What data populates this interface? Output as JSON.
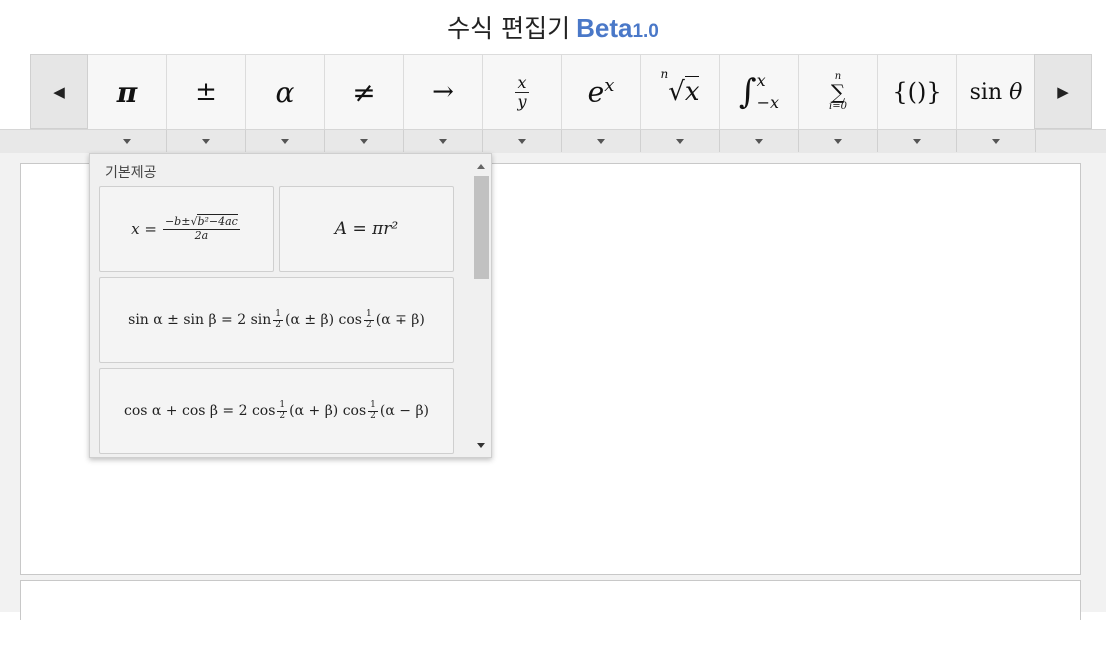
{
  "title": {
    "main": "수식 편집기",
    "beta": "Beta",
    "version": "1.0"
  },
  "toolbar": {
    "prev_icon": "triangle-left-icon",
    "next_icon": "triangle-right-icon",
    "symbols": [
      {
        "name": "pi",
        "label": "π"
      },
      {
        "name": "plus-minus",
        "label": "±"
      },
      {
        "name": "alpha",
        "label": "α"
      },
      {
        "name": "not-equal",
        "label": "≠"
      },
      {
        "name": "right-arrow",
        "label": "→"
      },
      {
        "name": "fraction",
        "num": "x",
        "den": "y"
      },
      {
        "name": "exponent",
        "base": "e",
        "exp": "x"
      },
      {
        "name": "nth-root",
        "index": "n",
        "radicand": "x"
      },
      {
        "name": "integral",
        "upper": "x",
        "lower": "−x"
      },
      {
        "name": "summation",
        "upper": "n",
        "lower": "i=0"
      },
      {
        "name": "brackets",
        "label": "{()}"
      },
      {
        "name": "sine",
        "label": "sin",
        "var": "θ"
      }
    ]
  },
  "dropdown": {
    "header": "기본제공",
    "formulas": {
      "quadratic": {
        "lhs": "x =",
        "num_pre": "−b±",
        "num_rad": "b²−4ac",
        "den": "2a"
      },
      "circle_area": {
        "text": "A = πr²"
      },
      "sum_to_product_sin": {
        "text_a": "sin α ± sin β = 2 sin",
        "text_b": "(α ± β) cos",
        "text_c": "(α ∓ β)",
        "half_num": "1",
        "half_den": "2"
      },
      "sum_to_product_cos": {
        "text_a": "cos α + cos β = 2 cos",
        "text_b": "(α + β) cos",
        "text_c": "(α − β)",
        "half_num": "1",
        "half_den": "2"
      }
    }
  }
}
